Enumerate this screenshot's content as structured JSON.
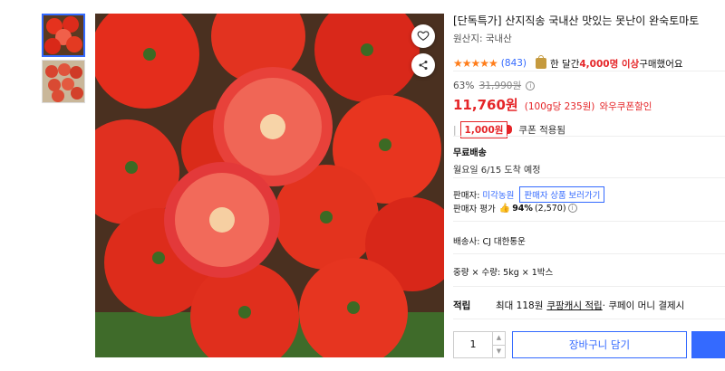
{
  "product": {
    "title": "[단독특가] 산지직송 국내산 맛있는 못난이 완숙토마토",
    "origin": "원산지: 국내산",
    "stars": "★★★★★",
    "review_count": "(843)",
    "bought_prefix": "한 달간 ",
    "bought_count": "4,000명 이상",
    "bought_suffix": " 구매했어요"
  },
  "price": {
    "discount": "63%",
    "original": "31,990원",
    "sale": "11,760원",
    "unit": "(100g당 235원)",
    "coupon_label": "와우쿠폰할인",
    "coupon_amount": "1,000원",
    "coupon_text": "쿠폰 적용됨"
  },
  "shipping": {
    "title": "무료배송",
    "date": "월요일 6/15 도착 예정"
  },
  "seller": {
    "label": "판매자:",
    "name": "미각농원",
    "button": "판매자 상품 보러가기",
    "eval_label": "판매자 평가",
    "eval_pct": "94%",
    "eval_count": "(2,570)"
  },
  "carrier": "배송사: CJ 대한통운",
  "option": "중량 × 수량: 5kg × 1박스",
  "earn": {
    "label": "적립",
    "prefix": "최대 118원",
    "link": "쿠팡캐시 적립",
    "suffix": " · 쿠페이 머니 결제시"
  },
  "purchase": {
    "quantity": "1",
    "cart_label": "장바구니 담기"
  },
  "colors": {
    "accent": "#346aff",
    "sale": "#e52528",
    "star": "#ff7d1a"
  }
}
